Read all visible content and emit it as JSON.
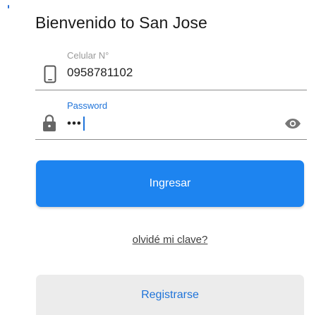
{
  "header": {
    "title": "Bienvenido to San Jose"
  },
  "form": {
    "phone": {
      "label": "Celular N°",
      "value": "0958781102",
      "icon": "smartphone-icon"
    },
    "password": {
      "label": "Password",
      "value": "•••",
      "icon": "lock-icon",
      "toggle_icon": "eye-icon"
    }
  },
  "actions": {
    "login_label": "Ingresar",
    "forgot_label": "olvidé mi clave?",
    "register_label": "Registrarse"
  },
  "colors": {
    "accent": "#1d84f0",
    "focus_label": "#1e73d9",
    "secondary_bg": "#ececec"
  }
}
